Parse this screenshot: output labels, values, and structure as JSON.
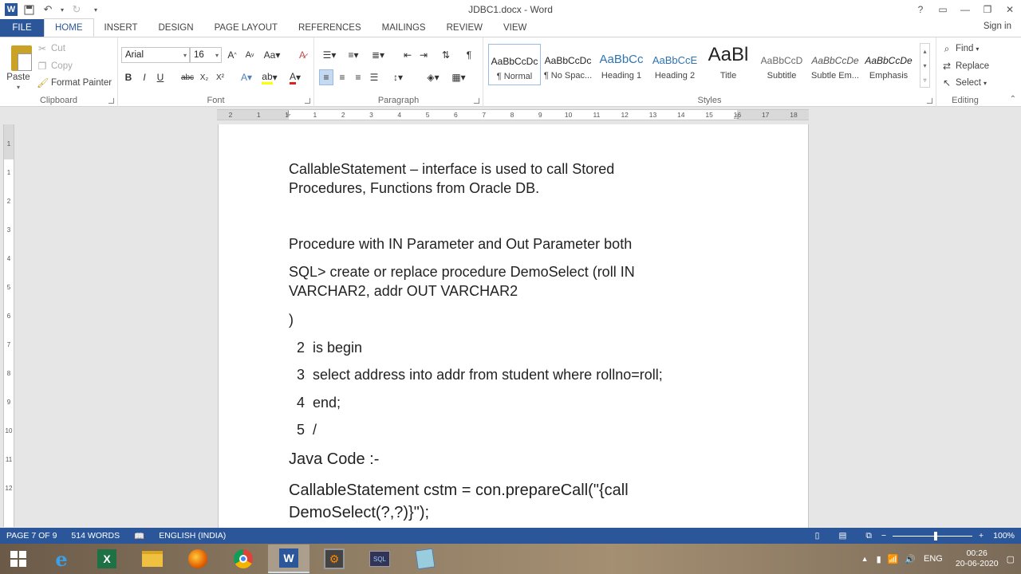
{
  "window": {
    "title": "JDBC1.docx - Word",
    "buttons": [
      "?",
      "restore",
      "minimize",
      "maximize",
      "close"
    ]
  },
  "ribbon_tabs": [
    "FILE",
    "HOME",
    "INSERT",
    "DESIGN",
    "PAGE LAYOUT",
    "REFERENCES",
    "MAILINGS",
    "REVIEW",
    "VIEW"
  ],
  "signin": "Sign in",
  "clipboard": {
    "paste": "Paste",
    "cut": "Cut",
    "copy": "Copy",
    "format_painter": "Format Painter",
    "label": "Clipboard"
  },
  "font": {
    "name": "Arial",
    "size": "16",
    "label": "Font",
    "buttons": [
      "B",
      "I",
      "U",
      "abc",
      "X₂",
      "X²"
    ]
  },
  "paragraph": {
    "label": "Paragraph"
  },
  "styles": {
    "label": "Styles",
    "items": [
      {
        "sample": "AaBbCcDc",
        "name": "¶ Normal"
      },
      {
        "sample": "AaBbCcDc",
        "name": "¶ No Spac..."
      },
      {
        "sample": "AaBbCc",
        "name": "Heading 1"
      },
      {
        "sample": "AaBbCcE",
        "name": "Heading 2"
      },
      {
        "sample": "AaBl",
        "name": "Title"
      },
      {
        "sample": "AaBbCcD",
        "name": "Subtitle"
      },
      {
        "sample": "AaBbCcDe",
        "name": "Subtle Em..."
      },
      {
        "sample": "AaBbCcDe",
        "name": "Emphasis"
      }
    ]
  },
  "editing": {
    "label": "Editing",
    "find": "Find",
    "replace": "Replace",
    "select": "Select"
  },
  "ruler": {
    "numbers": [
      "2",
      "1",
      "1",
      "1",
      "2",
      "3",
      "4",
      "5",
      "6",
      "7",
      "8",
      "9",
      "10",
      "11",
      "12",
      "13",
      "14",
      "15",
      "16",
      "17",
      "18"
    ]
  },
  "vruler": {
    "numbers": [
      "1",
      "1",
      "2",
      "3",
      "4",
      "5",
      "6",
      "7",
      "8",
      "9",
      "10",
      "11",
      "12"
    ]
  },
  "document": {
    "lines": [
      "CallableStatement – interface is used to call Stored",
      "Procedures, Functions from Oracle DB.",
      "Procedure with IN Parameter and Out Parameter both",
      "SQL> create or replace procedure DemoSelect (roll IN",
      "VARCHAR2, addr OUT VARCHAR2",
      ")",
      "  2  is begin",
      "  3  select address into addr from student where rollno=roll;",
      "  4  end;",
      "  5  /",
      "Java Code :-",
      "CallableStatement cstm = con.prepareCall(\"{call",
      "DemoSelect(?,?)}\");"
    ]
  },
  "status": {
    "page": "PAGE 7 OF 9",
    "words": "514 WORDS",
    "language": "ENGLISH (INDIA)",
    "zoom": "100%"
  },
  "taskbar": {
    "apps": [
      "internet-explorer",
      "excel",
      "file-explorer",
      "firefox",
      "chrome",
      "word",
      "setup",
      "sql",
      "notepad"
    ],
    "lang": "ENG",
    "time": "00:26",
    "date": "20-06-2020"
  }
}
